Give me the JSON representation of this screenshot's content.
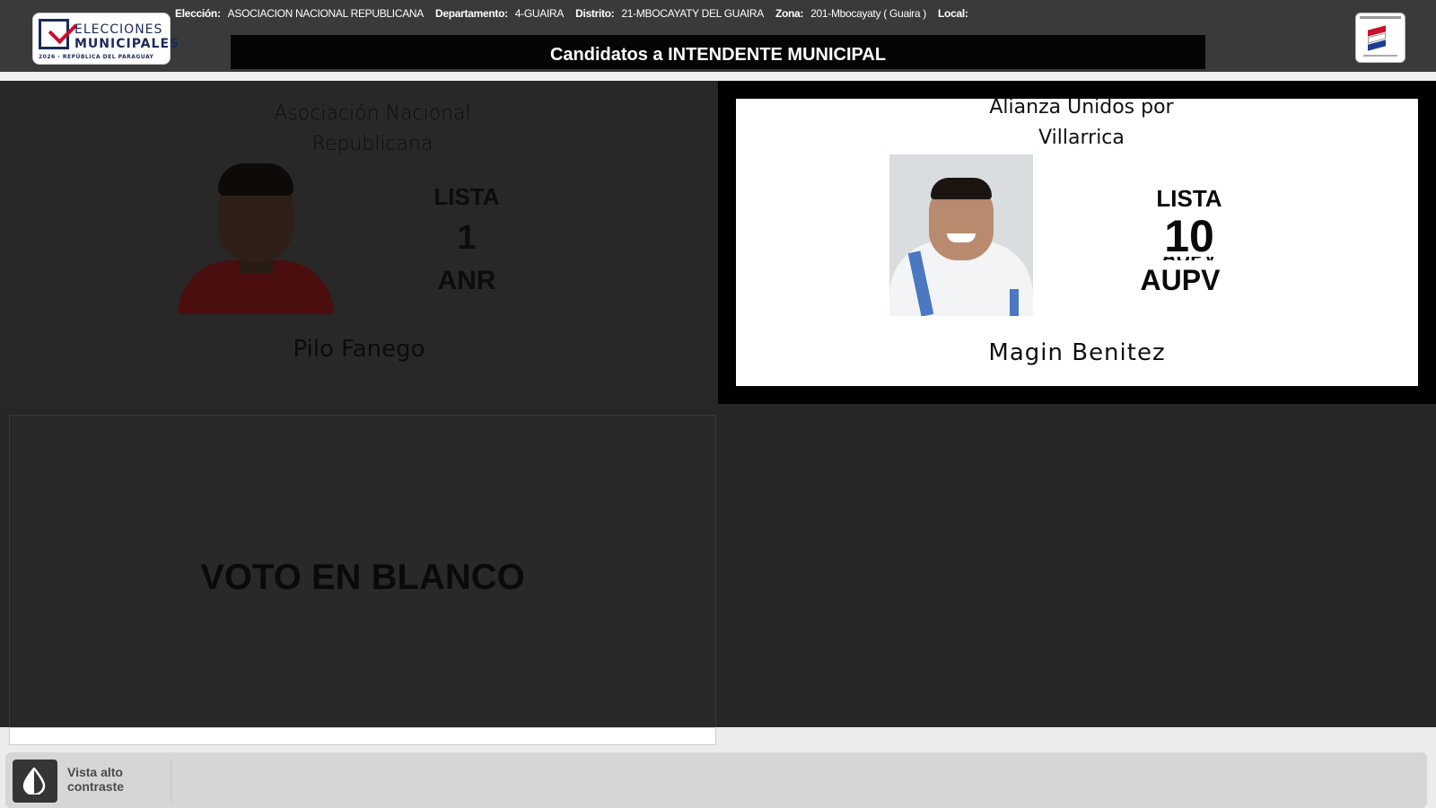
{
  "header": {
    "logo": {
      "line1": "ELECCIONES",
      "line2": "MUNICIPALES",
      "line3": "2026 - REPÚBLICA DEL PARAGUAY"
    },
    "info": {
      "eleccion_label": "Elección:",
      "eleccion_value": "ASOCIACION NACIONAL REPUBLICANA",
      "departamento_label": "Departamento:",
      "departamento_value": "4-GUAIRA",
      "distrito_label": "Distrito:",
      "distrito_value": "21-MBOCAYATY DEL GUAIRA",
      "zona_label": "Zona:",
      "zona_value": "201-Mbocayaty ( Guaira )",
      "local_label": "Local:",
      "local_value": ""
    },
    "title": "Candidatos a INTENDENTE MUNICIPAL"
  },
  "candidates": [
    {
      "party": "Asociación Nacional Republicana",
      "lista_label": "LISTA",
      "lista_number": "1",
      "sigla": "ANR",
      "name": "Pilo Fanego",
      "selected": false
    },
    {
      "party": "Alianza Unidos por Villarrica",
      "lista_label": "LISTA",
      "lista_number": "10",
      "sigla": "AUPV",
      "name": "Magin Benitez",
      "selected": true
    }
  ],
  "blank_vote": {
    "label": "VOTO EN BLANCO"
  },
  "footer": {
    "contrast_button_label": "Vista alto contraste"
  },
  "colors": {
    "header_bg": "#3a3a3a",
    "selected_frame": "#000000",
    "dimmed_bg": "#262626",
    "accent_red": "#c8102e",
    "accent_navy": "#1c2a59"
  },
  "icons": {
    "contrast": "drop-half-icon",
    "logo_left": "ballot-check-icon",
    "logo_right": "tsje-emblem-icon"
  }
}
